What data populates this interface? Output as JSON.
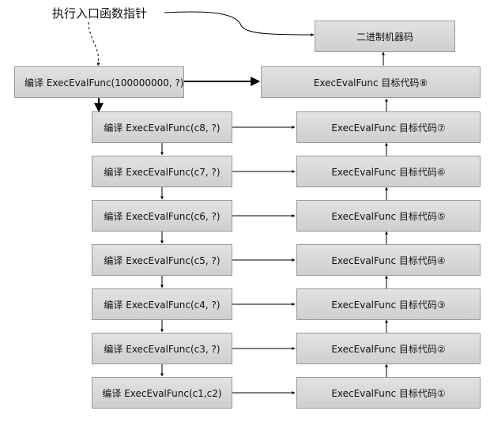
{
  "entry_label": "执行入口函数指针",
  "binary_label": "二进制机器码",
  "top_compile_label": "编译 ExecEvalFunc(100000000, ?)",
  "top_target_label": "ExecEvalFunc 目标代码⑧",
  "compile_labels": [
    "编译 ExecEvalFunc(c8, ?)",
    "编译 ExecEvalFunc(c7, ?)",
    "编译 ExecEvalFunc(c6, ?)",
    "编译 ExecEvalFunc(c5, ?)",
    "编译 ExecEvalFunc(c4, ?)",
    "编译 ExecEvalFunc(c3, ?)",
    "编译 ExecEvalFunc(c1,c2)"
  ],
  "target_labels": [
    "ExecEvalFunc 目标代码⑦",
    "ExecEvalFunc 目标代码⑥",
    "ExecEvalFunc 目标代码⑤",
    "ExecEvalFunc 目标代码④",
    "ExecEvalFunc 目标代码③",
    "ExecEvalFunc 目标代码②",
    "ExecEvalFunc 目标代码①"
  ]
}
